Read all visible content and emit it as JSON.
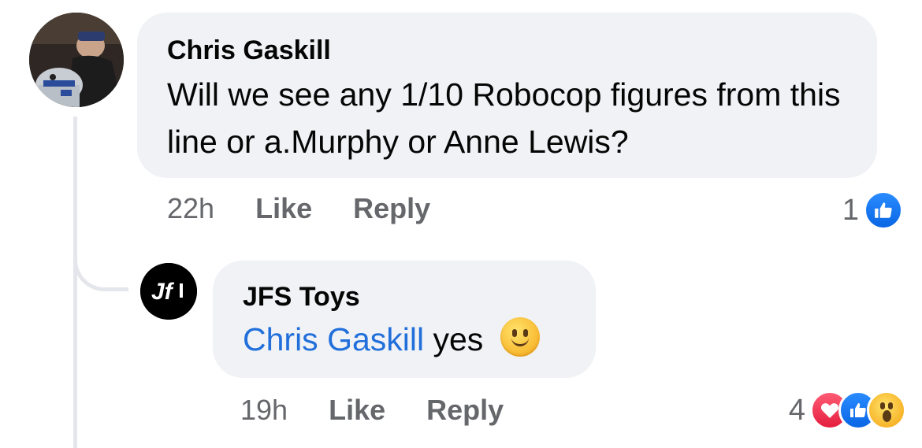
{
  "comment": {
    "author": "Chris Gaskill",
    "text": "Will we see any 1/10 Robocop figures from this line or a.Murphy or Anne Lewis?",
    "time": "22h",
    "like_label": "Like",
    "reply_label": "Reply",
    "reaction_count": "1",
    "reactions": [
      "like-icon"
    ]
  },
  "reply": {
    "author": "JFS Toys",
    "mention": "Chris Gaskill",
    "text": "yes",
    "emoji": "slightly-smiling-face-emoji",
    "time": "19h",
    "like_label": "Like",
    "reply_label": "Reply",
    "reaction_count": "4",
    "reactions": [
      "love-icon",
      "like-icon",
      "wow-icon"
    ],
    "avatar_logo_text": "Jf"
  },
  "colors": {
    "bubble": "#f0f2f5",
    "mention": "#216fdb",
    "meta": "#65676b",
    "like": "#0a66e4",
    "love": "#e41e3f"
  }
}
